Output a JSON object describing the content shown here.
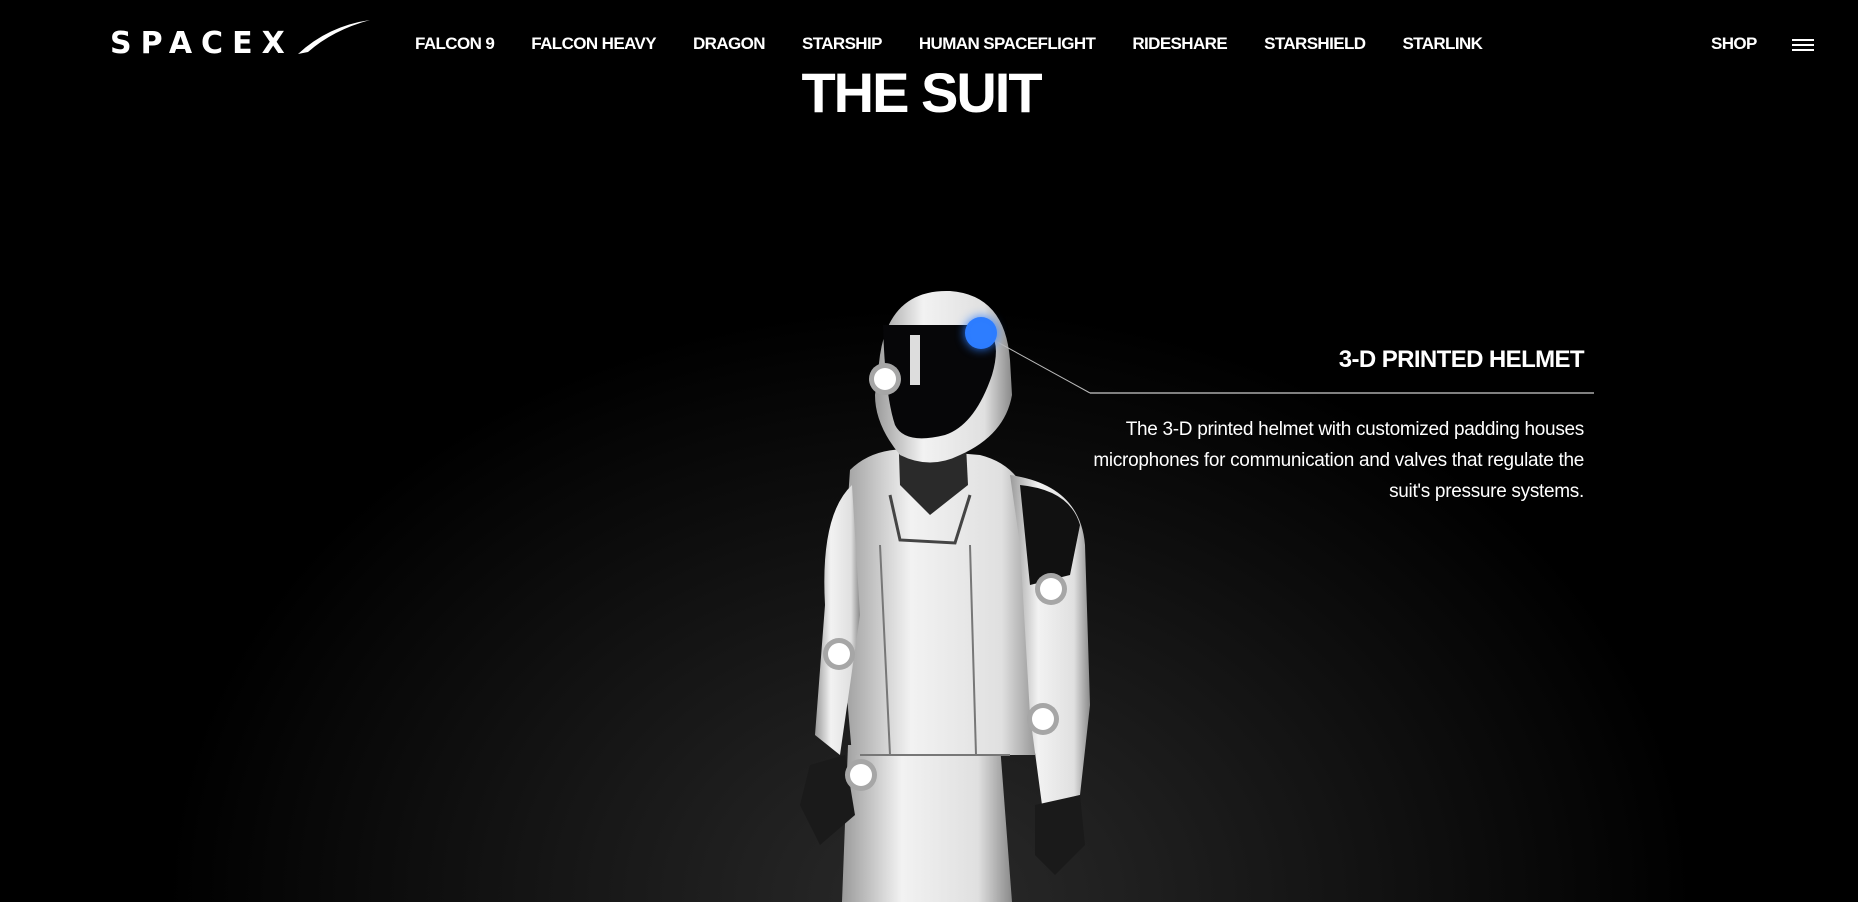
{
  "brand": "SPACEX",
  "nav": {
    "items": [
      "FALCON 9",
      "FALCON HEAVY",
      "DRAGON",
      "STARSHIP",
      "HUMAN SPACEFLIGHT",
      "RIDESHARE",
      "STARSHIELD",
      "STARLINK"
    ],
    "shop": "SHOP"
  },
  "page": {
    "title": "THE SUIT"
  },
  "feature": {
    "title": "3-D PRINTED HELMET",
    "description": "The 3-D printed helmet with customized padding houses microphones for communication and valves that regulate the suit's pressure systems."
  },
  "colors": {
    "accent": "#2d7dff",
    "background": "#000000"
  }
}
